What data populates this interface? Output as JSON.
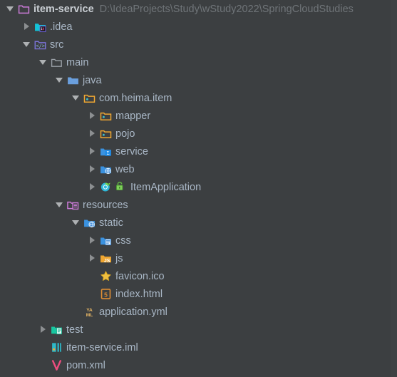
{
  "window": {
    "background_color": "#3c3f41",
    "text_color": "#a9b7c6",
    "muted_text_color": "#6f7478"
  },
  "tree": {
    "rows": [
      {
        "label": "item-service",
        "secondary": "D:\\IdeaProjects\\Study\\wStudy2022\\SpringCloudStudies",
        "indent": 0,
        "arrow": "expanded",
        "icon": "folder-module-root-icon",
        "bold": true,
        "lock": false
      },
      {
        "label": ".idea",
        "secondary": "",
        "indent": 1,
        "arrow": "collapsed",
        "icon": "folder-idea-icon",
        "bold": false,
        "lock": false
      },
      {
        "label": "src",
        "secondary": "",
        "indent": 1,
        "arrow": "expanded",
        "icon": "folder-sources-root-icon",
        "bold": false,
        "lock": false
      },
      {
        "label": "main",
        "secondary": "",
        "indent": 2,
        "arrow": "expanded",
        "icon": "folder-plain-icon",
        "bold": false,
        "lock": false
      },
      {
        "label": "java",
        "secondary": "",
        "indent": 3,
        "arrow": "expanded",
        "icon": "folder-java-source-icon",
        "bold": false,
        "lock": false
      },
      {
        "label": "com.heima.item",
        "secondary": "",
        "indent": 4,
        "arrow": "expanded",
        "icon": "package-icon",
        "bold": false,
        "lock": false
      },
      {
        "label": "mapper",
        "secondary": "",
        "indent": 5,
        "arrow": "collapsed",
        "icon": "package-icon",
        "bold": false,
        "lock": false
      },
      {
        "label": "pojo",
        "secondary": "",
        "indent": 5,
        "arrow": "collapsed",
        "icon": "package-icon",
        "bold": false,
        "lock": false
      },
      {
        "label": "service",
        "secondary": "",
        "indent": 5,
        "arrow": "collapsed",
        "icon": "folder-service-icon",
        "bold": false,
        "lock": false
      },
      {
        "label": "web",
        "secondary": "",
        "indent": 5,
        "arrow": "collapsed",
        "icon": "folder-web-icon",
        "bold": false,
        "lock": false
      },
      {
        "label": "ItemApplication",
        "secondary": "",
        "indent": 5,
        "arrow": "collapsed",
        "icon": "spring-boot-class-icon",
        "bold": false,
        "lock": true
      },
      {
        "label": "resources",
        "secondary": "",
        "indent": 3,
        "arrow": "expanded",
        "icon": "folder-resources-root-icon",
        "bold": false,
        "lock": false
      },
      {
        "label": "static",
        "secondary": "",
        "indent": 4,
        "arrow": "expanded",
        "icon": "folder-web-icon",
        "bold": false,
        "lock": false
      },
      {
        "label": "css",
        "secondary": "",
        "indent": 5,
        "arrow": "collapsed",
        "icon": "folder-css-icon",
        "bold": false,
        "lock": false
      },
      {
        "label": "js",
        "secondary": "",
        "indent": 5,
        "arrow": "collapsed",
        "icon": "folder-js-icon",
        "bold": false,
        "lock": false
      },
      {
        "label": "favicon.ico",
        "secondary": "",
        "indent": 5,
        "arrow": "none",
        "icon": "star-icon",
        "bold": false,
        "lock": false
      },
      {
        "label": "index.html",
        "secondary": "",
        "indent": 5,
        "arrow": "none",
        "icon": "html5-file-icon",
        "bold": false,
        "lock": false
      },
      {
        "label": "application.yml",
        "secondary": "",
        "indent": 4,
        "arrow": "none",
        "icon": "yaml-file-icon",
        "bold": false,
        "lock": false
      },
      {
        "label": "test",
        "secondary": "",
        "indent": 2,
        "arrow": "collapsed",
        "icon": "folder-test-root-icon",
        "bold": false,
        "lock": false
      },
      {
        "label": "item-service.iml",
        "secondary": "",
        "indent": 2,
        "arrow": "none",
        "icon": "iml-file-icon",
        "bold": false,
        "lock": false
      },
      {
        "label": "pom.xml",
        "secondary": "",
        "indent": 2,
        "arrow": "none",
        "icon": "maven-pom-icon",
        "bold": false,
        "lock": false
      }
    ]
  },
  "colors": {
    "folder_pink": "#cb7bd8",
    "folder_blue": "#6a9fdd",
    "folder_cyan": "#13c2d6",
    "folder_orange": "#f0a732",
    "folder_green": "#17c7a0",
    "folder_grey": "#9aa0a6",
    "lock_green": "#62b543",
    "maven_pink": "#ec4d7e",
    "iml_cyan": "#2eb8c8"
  }
}
